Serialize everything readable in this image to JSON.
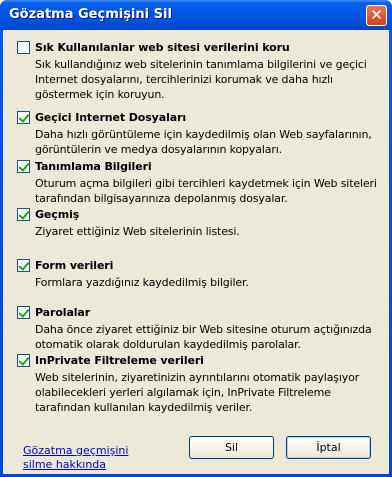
{
  "window": {
    "title": "Gözatma Geçmişini Sil",
    "close_glyph": "✕"
  },
  "options": [
    {
      "label": "Sık Kullanılanlar web sitesi verilerini koru",
      "checked": false,
      "description": "Sık kullandığınız web sitelerinin tanımlama bilgilerini ve geçici Internet dosyalarını, tercihlerinizi korumak ve daha hızlı göstermek için koruyun."
    },
    {
      "label": "Geçici Internet Dosyaları",
      "checked": true,
      "description": "Daha hızlı görüntüleme için kaydedilmiş olan Web sayfalarının, görüntülerin ve medya dosyalarının kopyaları."
    },
    {
      "label": "Tanımlama Bilgileri",
      "checked": true,
      "description": "Oturum açma bilgileri gibi tercihleri kaydetmek için Web siteleri tarafından bilgisayarınıza depolanmış dosyalar."
    },
    {
      "label": "Geçmiş",
      "checked": true,
      "description": "Ziyaret ettiğiniz Web sitelerinin listesi."
    },
    {
      "label": "Form verileri",
      "checked": true,
      "description": "Formlara yazdığınız kaydedilmiş bilgiler."
    },
    {
      "label": "Parolalar",
      "checked": true,
      "description": "Daha önce ziyaret ettiğiniz bir Web sitesine oturum açtığınızda otomatik olarak doldurulan kaydedilmiş parolalar."
    },
    {
      "label": "InPrivate Filtreleme verileri",
      "checked": true,
      "description": "Web sitelerinin, ziyaretinizin ayrıntılarını otomatik paylaşıyor olabilecekleri yerleri algılamak için, InPrivate Filtreleme tarafından kullanılan kaydedilmiş veriler."
    }
  ],
  "footer": {
    "link": "Gözatma geçmişini silme hakkında",
    "delete_button": "Sil",
    "cancel_button": "İptal"
  }
}
